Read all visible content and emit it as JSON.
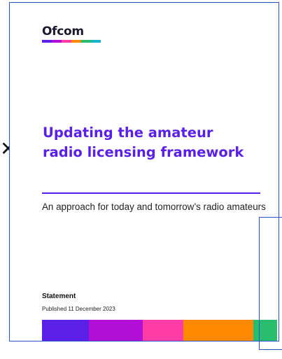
{
  "header": {
    "logo_text": "Ofcom",
    "logo_stripe_colors": [
      "#5a20e8",
      "#b20fd6",
      "#ff3ca6",
      "#ff8a00",
      "#2bbd6e",
      "#19b5c9"
    ]
  },
  "cover": {
    "title": "Updating the amateur radio licensing framework",
    "subtitle": "An approach for today and tomorrow’s radio amateurs",
    "document_type": "Statement",
    "published": "Published 11 December 2023",
    "accent_color": "#5a20e8"
  },
  "color_band": [
    {
      "color": "#5a20e8",
      "share": 0.2
    },
    {
      "color": "#b20fd6",
      "share": 0.23
    },
    {
      "color": "#ff3ca6",
      "share": 0.17
    },
    {
      "color": "#ff8a00",
      "share": 0.3
    },
    {
      "color": "#2bbd6e",
      "share": 0.1
    }
  ],
  "left_glyph": "✕"
}
